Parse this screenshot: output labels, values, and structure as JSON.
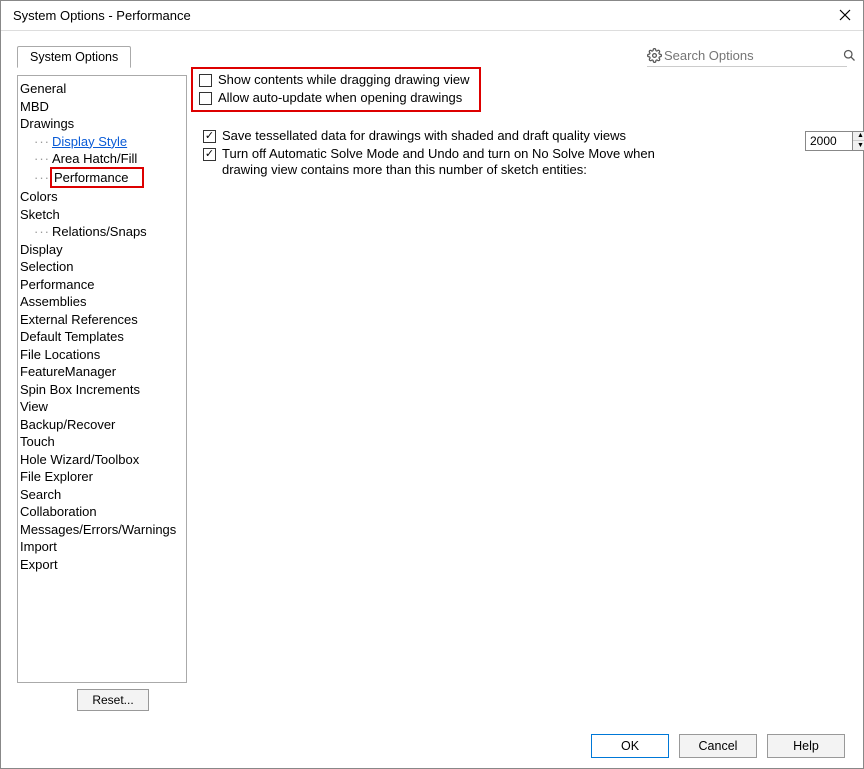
{
  "window": {
    "title": "System Options - Performance"
  },
  "tabs": {
    "tab1": "System Options"
  },
  "search": {
    "placeholder": "Search Options"
  },
  "tree": {
    "general": "General",
    "mbd": "MBD",
    "drawings": "Drawings",
    "display_style": "Display Style",
    "area_hatch": "Area Hatch/Fill",
    "performance_sub": "Performance",
    "colors": "Colors",
    "sketch": "Sketch",
    "relations_snaps": "Relations/Snaps",
    "display": "Display",
    "selection": "Selection",
    "performance": "Performance",
    "assemblies": "Assemblies",
    "ext_refs": "External References",
    "default_templates": "Default Templates",
    "file_locations": "File Locations",
    "feature_manager": "FeatureManager",
    "spinbox": "Spin Box Increments",
    "view": "View",
    "backup": "Backup/Recover",
    "touch": "Touch",
    "hole_wizard": "Hole Wizard/Toolbox",
    "file_explorer": "File Explorer",
    "search": "Search",
    "collaboration": "Collaboration",
    "messages": "Messages/Errors/Warnings",
    "import": "Import",
    "export": "Export"
  },
  "options": {
    "opt1": {
      "label": "Show contents while dragging drawing view",
      "checked": false
    },
    "opt2": {
      "label": "Allow auto-update when opening drawings",
      "checked": false
    },
    "opt3": {
      "label": "Save tessellated data for drawings with shaded and draft quality views",
      "checked": true
    },
    "opt4": {
      "label": "Turn off Automatic Solve Mode and Undo and turn on No Solve Move when drawing view contains more than this number of sketch entities:",
      "checked": true
    },
    "spinner_value": "2000"
  },
  "buttons": {
    "reset": "Reset...",
    "ok": "OK",
    "cancel": "Cancel",
    "help": "Help"
  }
}
